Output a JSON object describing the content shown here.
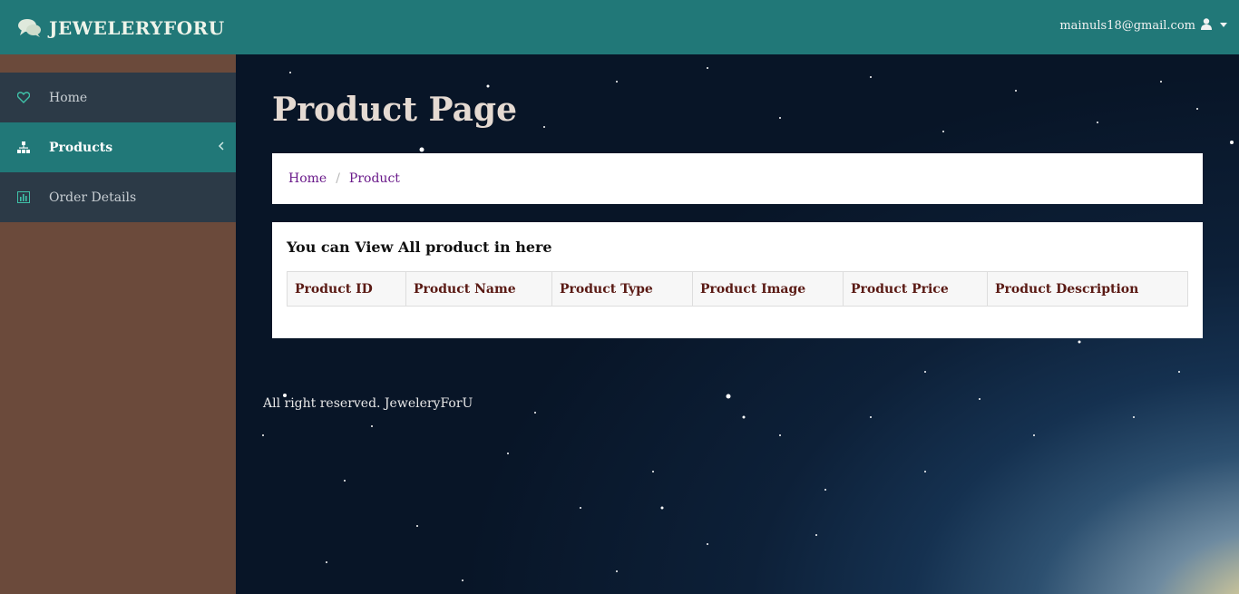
{
  "header": {
    "brand": "JEWELERYFORU",
    "user_email": "mainuls18@gmail.com",
    "colors": {
      "bar": "#217878"
    }
  },
  "sidebar": {
    "items": [
      {
        "label": "Home",
        "icon": "heart-icon"
      },
      {
        "label": "Products",
        "icon": "sitemap-icon",
        "active": true
      },
      {
        "label": "Order Details",
        "icon": "bar-chart-icon"
      }
    ]
  },
  "main": {
    "title": "Product Page",
    "breadcrumb": [
      "Home",
      "Product"
    ],
    "breadcrumb_separator": "/",
    "panel_heading": "You can View All product in here",
    "table": {
      "columns": [
        "Product ID",
        "Product Name",
        "Product Type",
        "Product Image",
        "Product Price",
        "Product Description"
      ],
      "rows": []
    },
    "footer": "All right reserved. JeweleryForU"
  }
}
